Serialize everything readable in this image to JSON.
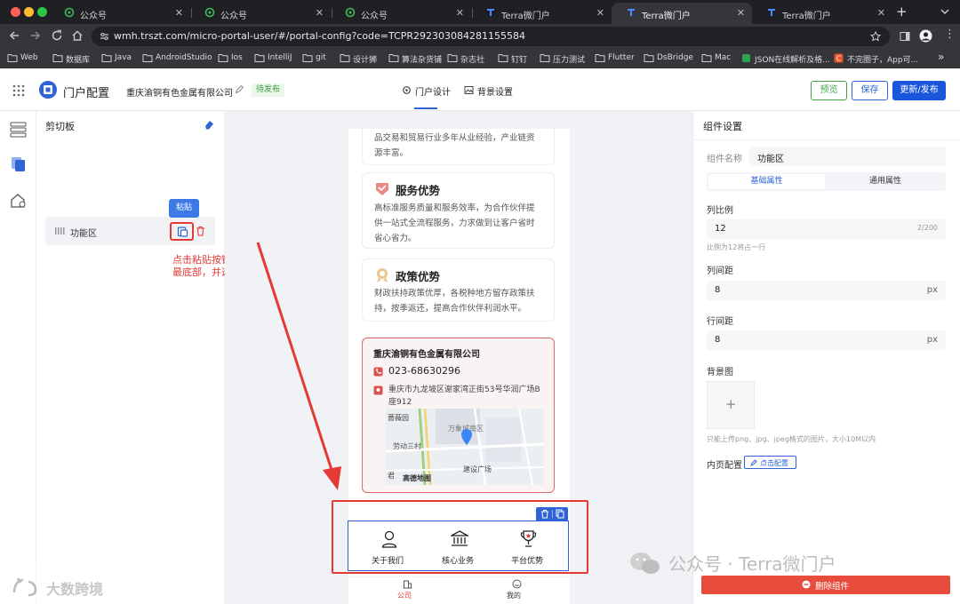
{
  "browser": {
    "tabs": [
      {
        "title": "公众号",
        "active": false
      },
      {
        "title": "公众号",
        "active": false
      },
      {
        "title": "公众号",
        "active": false
      },
      {
        "title": "Terra微门户",
        "active": false
      },
      {
        "title": "Terra微门户",
        "active": true
      },
      {
        "title": "Terra微门户",
        "active": false
      }
    ],
    "new_tab": "+",
    "url": "wmh.trszt.com/micro-portal-user/#/portal-config?code=TCPR292303084281155584",
    "bookmarks": [
      "Web",
      "数据库",
      "Java",
      "AndroidStudio",
      "Ios",
      "IntelliJ",
      "git",
      "设计狮",
      "算法杂货铺",
      "杂志社",
      "钉钉",
      "压力测试",
      "Flutter",
      "DsBridge",
      "Mac",
      "JSON在线解析及格...",
      "不完圈子，App可..."
    ],
    "more": "»"
  },
  "header": {
    "app_title": "门户配置",
    "company": "重庆渝铜有色金属有限公司",
    "status": "待发布",
    "tabs": [
      "门户设计",
      "背景设置"
    ],
    "buttons": {
      "preview": "预览",
      "save": "保存",
      "publish": "更新/发布"
    }
  },
  "clipboard": {
    "title": "剪切板",
    "item_label": "功能区",
    "tooltip": "粘贴",
    "annotation": [
      "点击粘贴按钮，组件将默认添加到大纲树",
      "最底部，并选中组件"
    ]
  },
  "preview": {
    "intro_tail": [
      "品交易和贸易行业多年从业经验，产业链资",
      "源丰富。"
    ],
    "cards": [
      {
        "title": "服务优势",
        "lines": [
          "高标准服务质量和服务效率，为合作伙伴提",
          "供一站式全流程服务，力求做到让客户省时",
          "省心省力。"
        ]
      },
      {
        "title": "政策优势",
        "lines": [
          "财政扶持政策优厚，各税种地方留存政策扶",
          "持，按季返还，提高合作伙伴利润水平。"
        ]
      }
    ],
    "contact": {
      "company": "重庆渝铜有色金属有限公司",
      "phone": "023-68630296",
      "address": [
        "重庆市九龙坡区谢家湾正街53号华润广场B",
        "座912"
      ]
    },
    "map": {
      "labels": [
        "蔷薇园",
        "万象城南区",
        "劳动三村",
        "建设广场",
        "高德地图",
        "君"
      ]
    },
    "features": [
      "关于我们",
      "核心业务",
      "平台优势"
    ],
    "bottom_nav": [
      "公司",
      "我的"
    ]
  },
  "panel": {
    "title": "组件设置",
    "name_label": "组件名称",
    "name_value": "功能区",
    "tabs": [
      "基础属性",
      "通用属性"
    ],
    "col_ratio_label": "列比例",
    "col_ratio_value": "12",
    "col_ratio_count": "2/200",
    "col_ratio_hint": "比例为12将占一行",
    "col_gap_label": "列间距",
    "col_gap_value": "8",
    "row_gap_label": "行间距",
    "row_gap_value": "8",
    "unit": "px",
    "bg_label": "背景图",
    "upload_plus": "+",
    "upload_hint": "只能上传png、jpg、jpeg格式的图片，大小10M以内",
    "inner_label": "内页配置",
    "inner_button": "点击配置",
    "delete_button": "删除组件"
  },
  "watermark": {
    "left": "大数跨境",
    "right": "公众号 · Terra微门户"
  },
  "colors": {
    "primary": "#2f63d6",
    "publish": "#1a56db",
    "preview_green": "#43a047",
    "annotation_red": "#e53935",
    "delete_red": "#e74c3c",
    "tab_active": "#35363a"
  }
}
